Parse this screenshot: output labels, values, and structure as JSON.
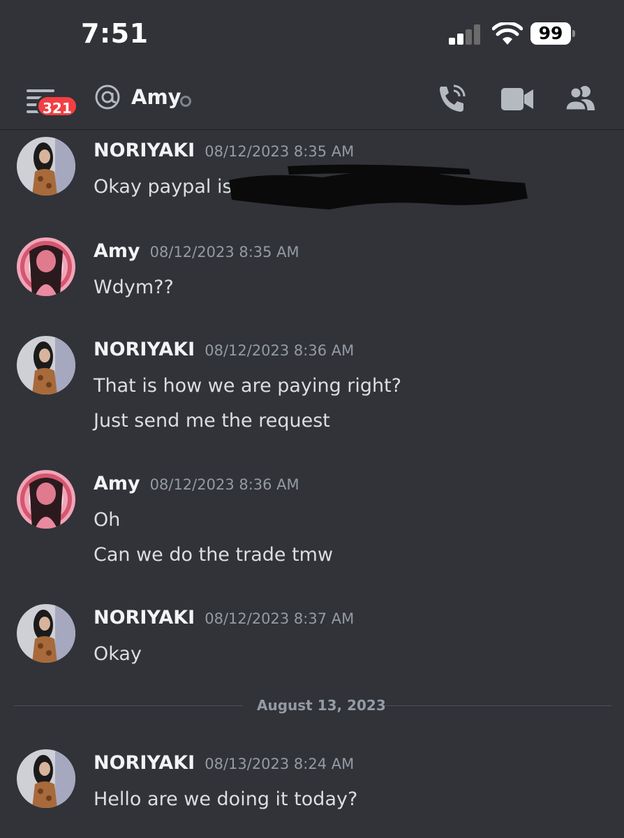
{
  "status_bar": {
    "time": "7:51",
    "battery": "99"
  },
  "header": {
    "unread_badge": "321",
    "channel_name": "Amy",
    "icons": [
      "hamburger-menu-icon",
      "at-icon",
      "phone-call-icon",
      "video-camera-icon",
      "members-icon"
    ]
  },
  "messages": [
    {
      "author": "NORIYAKI",
      "timestamp": "08/12/2023 8:35 AM",
      "lines": [
        "Okay paypal is"
      ]
    },
    {
      "author": "Amy",
      "timestamp": "08/12/2023 8:35 AM",
      "lines": [
        "Wdym??"
      ]
    },
    {
      "author": "NORIYAKI",
      "timestamp": "08/12/2023 8:36 AM",
      "lines": [
        "That is how we are paying right?",
        "Just send me the request"
      ]
    },
    {
      "author": "Amy",
      "timestamp": "08/12/2023 8:36 AM",
      "lines": [
        "Oh",
        "Can we do the trade tmw"
      ]
    },
    {
      "author": "NORIYAKI",
      "timestamp": "08/12/2023 8:37 AM",
      "lines": [
        "Okay"
      ]
    },
    {
      "author": "NORIYAKI",
      "timestamp": "08/13/2023 8:24 AM",
      "lines": [
        "Hello are we doing it today?"
      ]
    }
  ],
  "date_divider": "August 13, 2023",
  "colors": {
    "background": "#313338",
    "badge": "#f23f43",
    "muted_text": "#949ba4"
  }
}
